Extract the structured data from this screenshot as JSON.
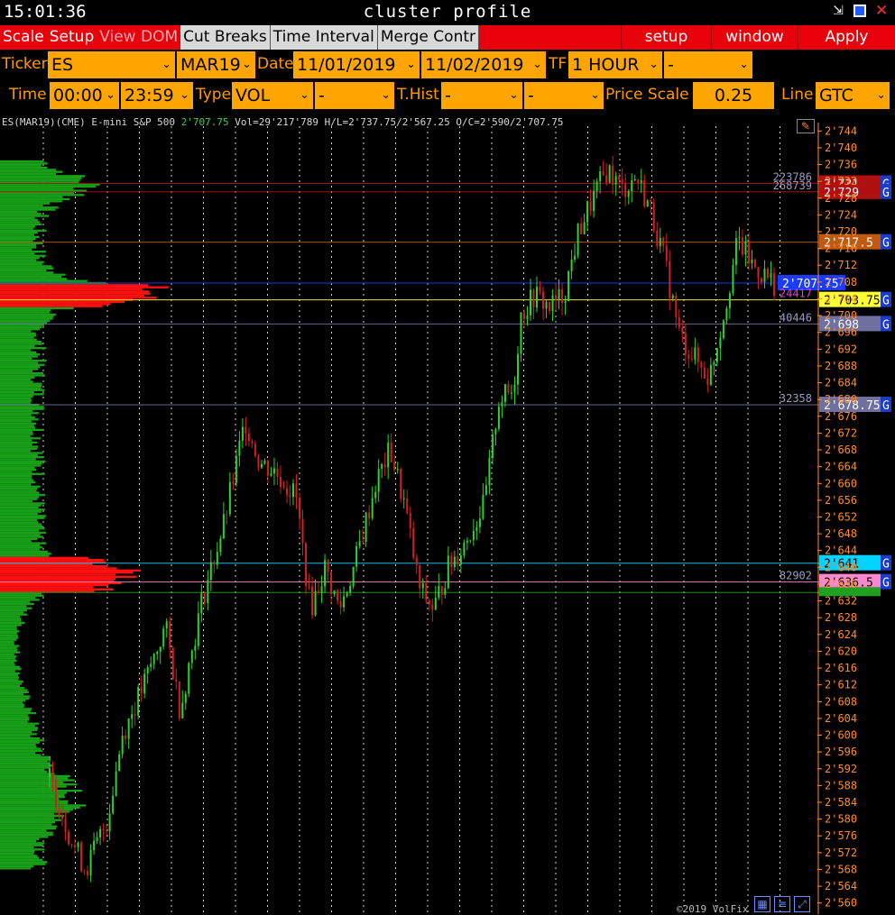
{
  "window": {
    "clock": "15:01:36",
    "title": "cluster profile",
    "minimize_icon": "minimize-icon",
    "maximize_icon": "maximize-icon",
    "close_icon": "close-icon"
  },
  "menu": {
    "left": [
      {
        "label": "Scale",
        "style": "red"
      },
      {
        "label": "Setup",
        "style": "red"
      },
      {
        "label": "View DOM",
        "style": "dim"
      },
      {
        "label": "Cut Breaks",
        "style": "gray"
      },
      {
        "label": "Time Interval",
        "style": "gray"
      },
      {
        "label": "Merge Contr",
        "style": "gray"
      }
    ],
    "right": [
      "setup",
      "window",
      "Apply"
    ]
  },
  "row1": {
    "ticker_label": "Ticker",
    "ticker_value": "ES",
    "contract_value": "MAR19",
    "date_label": "Date",
    "date_from": "11/01/2019",
    "date_to": "11/02/2019",
    "tf_label": "TF",
    "tf_value": "1 HOUR",
    "tf_extra": "-"
  },
  "row2": {
    "time_label": "Time",
    "time_from": "00:00",
    "time_to": "23:59",
    "type_label": "Type",
    "type_value": "VOL",
    "type_extra": "-",
    "thist_label": "T.Hist",
    "thist_value": "-",
    "thist_extra": "-",
    "price_scale_label": "Price Scale",
    "price_scale_value": "0.25",
    "line_label": "Line",
    "line_value": "GTC"
  },
  "chart_header": {
    "symbol": "ES(MAR19)(CME) E-mini S&P 500",
    "close": "2'707.75",
    "rest": "Vol=29'217'789 H/L=2'737.75/2'567.25 O/C=2'590/2'707.75"
  },
  "copyright": "©2019 VolFix",
  "chart_data": {
    "type": "candlestick",
    "y_range": [
      2558,
      2746
    ],
    "y_ticks": [
      "2'744",
      "2'740",
      "2'736",
      "2'732",
      "2'728",
      "2'724",
      "2'720",
      "2'716",
      "2'712",
      "2'708",
      "2'704",
      "2'700",
      "2'696",
      "2'692",
      "2'688",
      "2'684",
      "2'680",
      "2'676",
      "2'672",
      "2'668",
      "2'664",
      "2'660",
      "2'656",
      "2'652",
      "2'648",
      "2'644",
      "2'640",
      "2'636",
      "2'632",
      "2'628",
      "2'624",
      "2'620",
      "2'616",
      "2'612",
      "2'608",
      "2'604",
      "2'600",
      "2'596",
      "2'592",
      "2'588",
      "2'584",
      "2'580",
      "2'576",
      "2'572",
      "2'568",
      "2'564",
      "2'560"
    ],
    "open": 2590,
    "close": 2707.75,
    "high": 2737.75,
    "low": 2567.25,
    "path": [
      [
        0,
        2590
      ],
      [
        0.03,
        2575
      ],
      [
        0.05,
        2568
      ],
      [
        0.08,
        2580
      ],
      [
        0.1,
        2600
      ],
      [
        0.13,
        2612
      ],
      [
        0.16,
        2626
      ],
      [
        0.18,
        2606
      ],
      [
        0.21,
        2632
      ],
      [
        0.24,
        2650
      ],
      [
        0.27,
        2675
      ],
      [
        0.29,
        2665
      ],
      [
        0.31,
        2663
      ],
      [
        0.34,
        2657
      ],
      [
        0.36,
        2630
      ],
      [
        0.38,
        2640
      ],
      [
        0.4,
        2630
      ],
      [
        0.42,
        2640
      ],
      [
        0.45,
        2660
      ],
      [
        0.47,
        2668
      ],
      [
        0.49,
        2655
      ],
      [
        0.51,
        2635
      ],
      [
        0.53,
        2630
      ],
      [
        0.55,
        2640
      ],
      [
        0.57,
        2645
      ],
      [
        0.6,
        2655
      ],
      [
        0.62,
        2680
      ],
      [
        0.64,
        2682
      ],
      [
        0.65,
        2700
      ],
      [
        0.67,
        2705
      ],
      [
        0.69,
        2702
      ],
      [
        0.71,
        2705
      ],
      [
        0.73,
        2720
      ],
      [
        0.75,
        2728
      ],
      [
        0.77,
        2735
      ],
      [
        0.79,
        2730
      ],
      [
        0.81,
        2733
      ],
      [
        0.83,
        2725
      ],
      [
        0.85,
        2712
      ],
      [
        0.87,
        2695
      ],
      [
        0.89,
        2690
      ],
      [
        0.91,
        2685
      ],
      [
        0.93,
        2700
      ],
      [
        0.95,
        2718
      ],
      [
        0.97,
        2712
      ],
      [
        1,
        2707.75
      ]
    ],
    "price_levels": [
      {
        "price": "2'731",
        "volume": "223786",
        "color": "#b01010",
        "val": 2731.5
      },
      {
        "price": "2'729",
        "volume": "268739",
        "color": "#b01010",
        "val": 2729.5
      },
      {
        "price": "2'717.5",
        "volume": "",
        "color": "#c05a10",
        "val": 2717.5
      },
      {
        "price": "2'707.75",
        "volume": "",
        "color": "#1a3cff",
        "val": 2707.75,
        "current": true
      },
      {
        "price": "2'703.75",
        "volume": "24417",
        "color": "#ffff33",
        "val": 2703.75
      },
      {
        "price": "2'698",
        "volume": "40446",
        "color": "#7070a0",
        "val": 2698
      },
      {
        "price": "2'678.75",
        "volume": "32358",
        "color": "#7070a0",
        "val": 2678.75
      },
      {
        "price": "2'641",
        "volume": "",
        "color": "#00d4ff",
        "val": 2641
      },
      {
        "price": "2'636.5",
        "volume": "82902",
        "color": "#ff88cc",
        "val": 2636.5
      },
      {
        "price": "",
        "volume": "",
        "color": "#20a020",
        "val": 2634
      }
    ]
  }
}
